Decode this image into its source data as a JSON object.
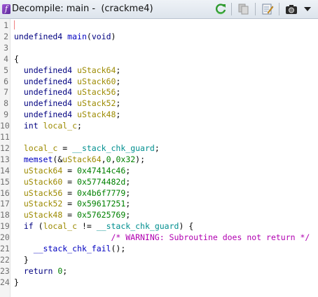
{
  "window": {
    "title": "Decompile: main -  (crackme4)"
  },
  "toolbar": {
    "icons": [
      "refresh-icon",
      "copy-icon",
      "edit-icon",
      "snapshot-icon",
      "dropdown-arrow-icon"
    ]
  },
  "colors": {
    "type": "#000080",
    "local_var": "#9c8a00",
    "global": "#008f8f",
    "function": "#0000c0",
    "number": "#008000",
    "comment": "#b000b0"
  },
  "code": {
    "lines": [
      {
        "num": "1",
        "tokens": []
      },
      {
        "num": "2",
        "tokens": [
          {
            "t": "undefined4 ",
            "c": "kw"
          },
          {
            "t": "main",
            "c": "fn"
          },
          {
            "t": "(",
            "c": "plain"
          },
          {
            "t": "void",
            "c": "kw"
          },
          {
            "t": ")",
            "c": "plain"
          }
        ]
      },
      {
        "num": "3",
        "tokens": []
      },
      {
        "num": "4",
        "tokens": [
          {
            "t": "{",
            "c": "plain"
          }
        ]
      },
      {
        "num": "5",
        "tokens": [
          {
            "t": "  undefined4 ",
            "c": "kw"
          },
          {
            "t": "uStack64",
            "c": "var"
          },
          {
            "t": ";",
            "c": "plain"
          }
        ]
      },
      {
        "num": "6",
        "tokens": [
          {
            "t": "  undefined4 ",
            "c": "kw"
          },
          {
            "t": "uStack60",
            "c": "var"
          },
          {
            "t": ";",
            "c": "plain"
          }
        ]
      },
      {
        "num": "7",
        "tokens": [
          {
            "t": "  undefined4 ",
            "c": "kw"
          },
          {
            "t": "uStack56",
            "c": "var"
          },
          {
            "t": ";",
            "c": "plain"
          }
        ]
      },
      {
        "num": "8",
        "tokens": [
          {
            "t": "  undefined4 ",
            "c": "kw"
          },
          {
            "t": "uStack52",
            "c": "var"
          },
          {
            "t": ";",
            "c": "plain"
          }
        ]
      },
      {
        "num": "9",
        "tokens": [
          {
            "t": "  undefined4 ",
            "c": "kw"
          },
          {
            "t": "uStack48",
            "c": "var"
          },
          {
            "t": ";",
            "c": "plain"
          }
        ]
      },
      {
        "num": "10",
        "tokens": [
          {
            "t": "  int ",
            "c": "kw"
          },
          {
            "t": "local_c",
            "c": "var"
          },
          {
            "t": ";",
            "c": "plain"
          }
        ]
      },
      {
        "num": "11",
        "tokens": []
      },
      {
        "num": "12",
        "tokens": [
          {
            "t": "  ",
            "c": "plain"
          },
          {
            "t": "local_c",
            "c": "var"
          },
          {
            "t": " = ",
            "c": "plain"
          },
          {
            "t": "__stack_chk_guard",
            "c": "glob"
          },
          {
            "t": ";",
            "c": "plain"
          }
        ]
      },
      {
        "num": "13",
        "tokens": [
          {
            "t": "  ",
            "c": "plain"
          },
          {
            "t": "memset",
            "c": "fn"
          },
          {
            "t": "(&",
            "c": "plain"
          },
          {
            "t": "uStack64",
            "c": "var"
          },
          {
            "t": ",",
            "c": "plain"
          },
          {
            "t": "0",
            "c": "num"
          },
          {
            "t": ",",
            "c": "plain"
          },
          {
            "t": "0x32",
            "c": "num"
          },
          {
            "t": ");",
            "c": "plain"
          }
        ]
      },
      {
        "num": "14",
        "tokens": [
          {
            "t": "  ",
            "c": "plain"
          },
          {
            "t": "uStack64",
            "c": "var"
          },
          {
            "t": " = ",
            "c": "plain"
          },
          {
            "t": "0x47414c46",
            "c": "num"
          },
          {
            "t": ";",
            "c": "plain"
          }
        ]
      },
      {
        "num": "15",
        "tokens": [
          {
            "t": "  ",
            "c": "plain"
          },
          {
            "t": "uStack60",
            "c": "var"
          },
          {
            "t": " = ",
            "c": "plain"
          },
          {
            "t": "0x5774482d",
            "c": "num"
          },
          {
            "t": ";",
            "c": "plain"
          }
        ]
      },
      {
        "num": "16",
        "tokens": [
          {
            "t": "  ",
            "c": "plain"
          },
          {
            "t": "uStack56",
            "c": "var"
          },
          {
            "t": " = ",
            "c": "plain"
          },
          {
            "t": "0x4b6f7779",
            "c": "num"
          },
          {
            "t": ";",
            "c": "plain"
          }
        ]
      },
      {
        "num": "17",
        "tokens": [
          {
            "t": "  ",
            "c": "plain"
          },
          {
            "t": "uStack52",
            "c": "var"
          },
          {
            "t": " = ",
            "c": "plain"
          },
          {
            "t": "0x59617251",
            "c": "num"
          },
          {
            "t": ";",
            "c": "plain"
          }
        ]
      },
      {
        "num": "18",
        "tokens": [
          {
            "t": "  ",
            "c": "plain"
          },
          {
            "t": "uStack48",
            "c": "var"
          },
          {
            "t": " = ",
            "c": "plain"
          },
          {
            "t": "0x57625769",
            "c": "num"
          },
          {
            "t": ";",
            "c": "plain"
          }
        ]
      },
      {
        "num": "19",
        "tokens": [
          {
            "t": "  if ",
            "c": "kw"
          },
          {
            "t": "(",
            "c": "plain"
          },
          {
            "t": "local_c",
            "c": "var"
          },
          {
            "t": " != ",
            "c": "plain"
          },
          {
            "t": "__stack_chk_guard",
            "c": "glob"
          },
          {
            "t": ") {",
            "c": "plain"
          }
        ]
      },
      {
        "num": "20",
        "tokens": [
          {
            "t": "                    /* WARNING: Subroutine does not return */",
            "c": "cmt"
          }
        ]
      },
      {
        "num": "21",
        "tokens": [
          {
            "t": "    ",
            "c": "plain"
          },
          {
            "t": "__stack_chk_fail",
            "c": "fn"
          },
          {
            "t": "();",
            "c": "plain"
          }
        ]
      },
      {
        "num": "22",
        "tokens": [
          {
            "t": "  }",
            "c": "plain"
          }
        ]
      },
      {
        "num": "23",
        "tokens": [
          {
            "t": "  return ",
            "c": "kw"
          },
          {
            "t": "0",
            "c": "num"
          },
          {
            "t": ";",
            "c": "plain"
          }
        ]
      },
      {
        "num": "24",
        "tokens": [
          {
            "t": "}",
            "c": "plain"
          }
        ]
      }
    ]
  }
}
